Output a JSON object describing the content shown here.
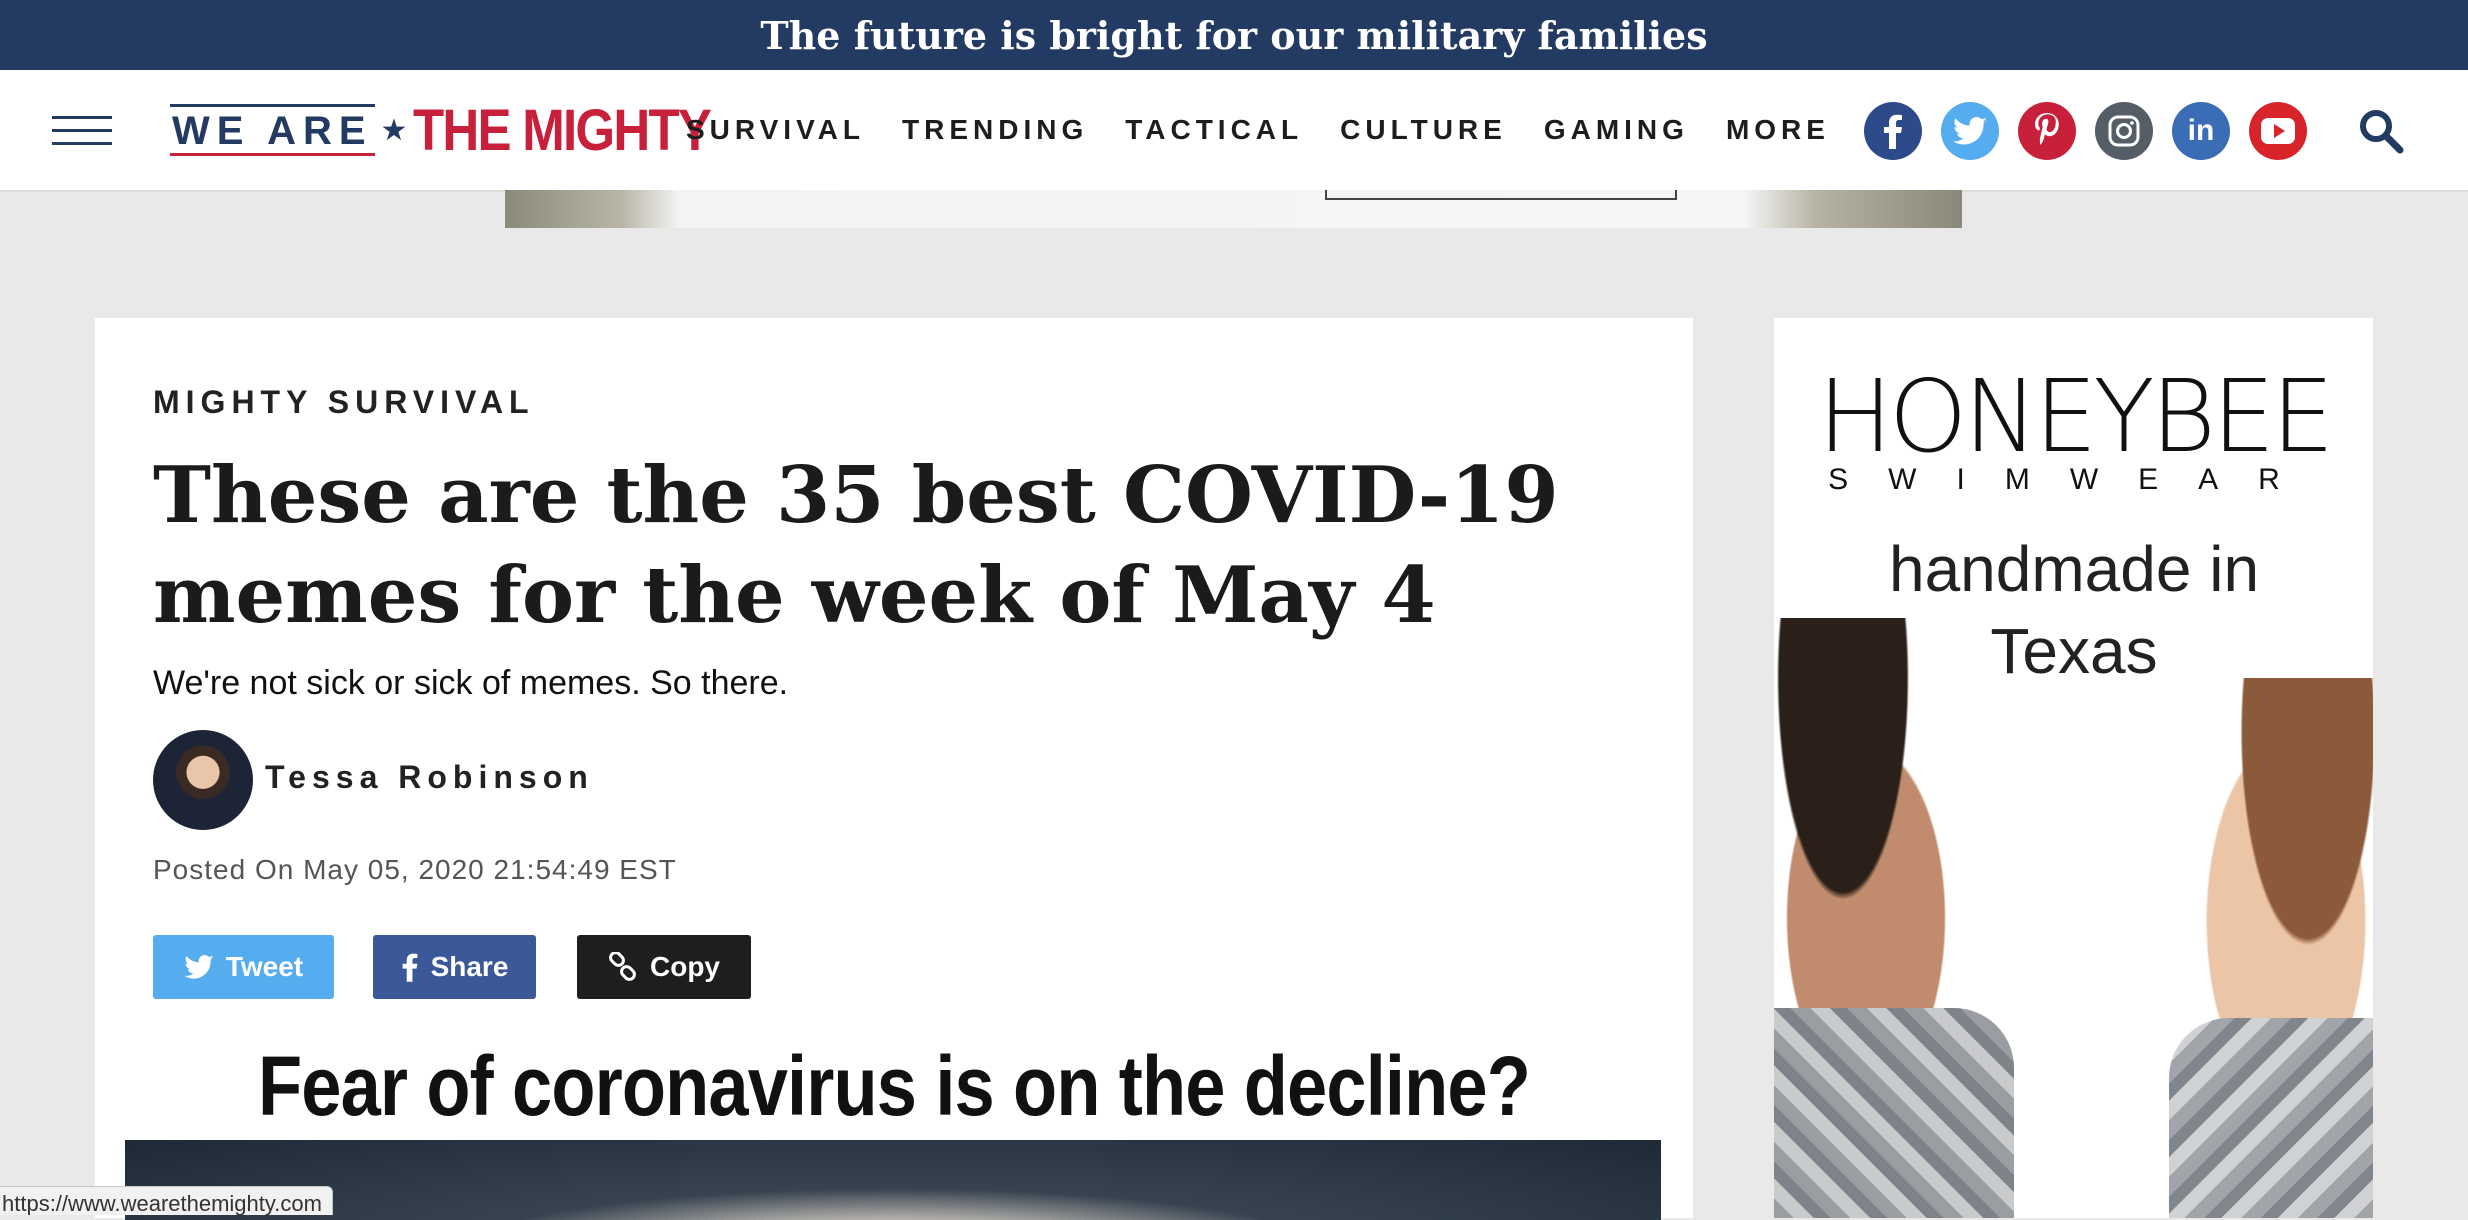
{
  "topbar": {
    "text": "The future is bright for our military families"
  },
  "header": {
    "logo": {
      "part1": "WE ARE",
      "star": "★",
      "part2": "THE MIGHTY"
    },
    "nav": [
      "SURVIVAL",
      "TRENDING",
      "TACTICAL",
      "CULTURE",
      "GAMING",
      "MORE"
    ],
    "socials": [
      {
        "name": "facebook-icon",
        "glyph": "f",
        "color": "#2d4a8a"
      },
      {
        "name": "twitter-icon",
        "glyph": "🐦",
        "color": "#55acee"
      },
      {
        "name": "pinterest-icon",
        "glyph": "P",
        "color": "#c8203a"
      },
      {
        "name": "instagram-icon",
        "glyph": "◎",
        "color": "#555d66"
      },
      {
        "name": "linkedin-icon",
        "glyph": "in",
        "color": "#3a6db5"
      },
      {
        "name": "youtube-icon",
        "glyph": "▶",
        "color": "#d8232a"
      }
    ]
  },
  "article": {
    "category": "MIGHTY SURVIVAL",
    "title": "These are the 35 best COVID-19 memes for the week of May 4",
    "subtitle": "We're not sick or sick of memes. So there.",
    "author": "Tessa Robinson",
    "posted": "Posted On May 05, 2020 21:54:49 EST",
    "buttons": {
      "tweet": "Tweet",
      "share": "Share",
      "copy": "Copy"
    },
    "meme_caption": "Fear of coronavirus is on the decline?"
  },
  "side_ad": {
    "brand": "HONEYBEE",
    "brand_sub": "SWIMWEAR",
    "tagline_line1": "handmade in",
    "tagline_line2": "Texas"
  },
  "statusbar": {
    "url": "https://www.wearethemighty.com"
  },
  "colors": {
    "navy": "#233a63",
    "red": "#c8203a",
    "twitter": "#55acee",
    "facebook": "#3b5998",
    "copy": "#1e1e1e"
  }
}
